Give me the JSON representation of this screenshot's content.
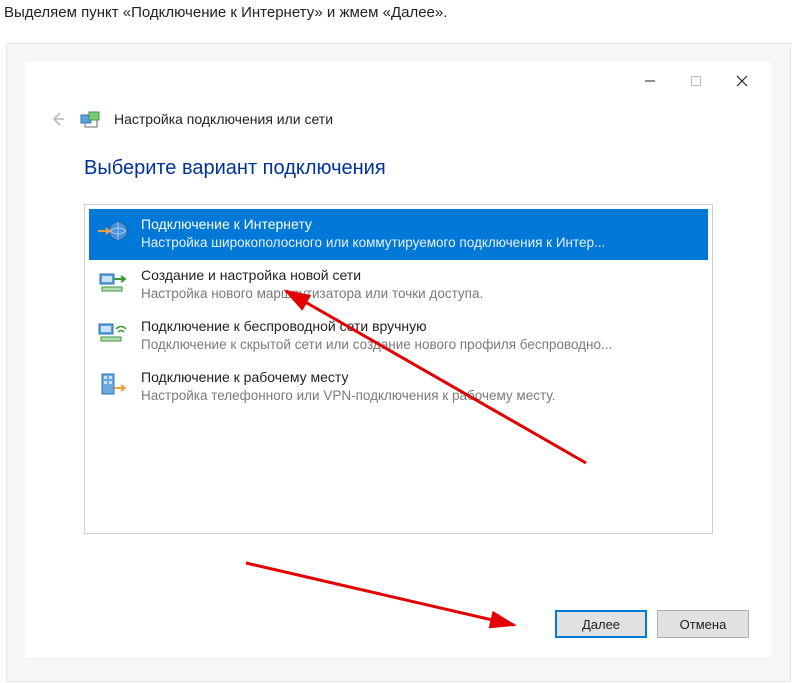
{
  "caption": "Выделяем пункт «Подключение к Интернету» и жмем «Далее».",
  "header": {
    "title": "Настройка подключения или сети"
  },
  "heading": "Выберите вариант подключения",
  "options": [
    {
      "title": "Подключение к Интернету",
      "desc": "Настройка широкополосного или коммутируемого подключения к Интер..."
    },
    {
      "title": "Создание и настройка новой сети",
      "desc": "Настройка нового маршрутизатора или точки доступа."
    },
    {
      "title": "Подключение к беспроводной сети вручную",
      "desc": "Подключение к скрытой сети или создание нового профиля беспроводно..."
    },
    {
      "title": "Подключение к рабочему месту",
      "desc": "Настройка телефонного или VPN-подключения к рабочему месту."
    }
  ],
  "buttons": {
    "next": "Далее",
    "cancel": "Отмена"
  }
}
